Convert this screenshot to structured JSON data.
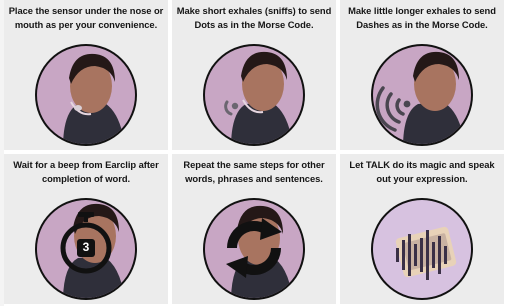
{
  "panels": [
    {
      "caption": "Place the sensor under the nose or\nmouth as per your convenience.",
      "icon": "face-sensor"
    },
    {
      "caption": "Make short exhales (sniffs) to send\nDots as in the Morse Code.",
      "icon": "short-exhale-waves"
    },
    {
      "caption": "Make little longer exhales to send\nDashes as in the Morse Code.",
      "icon": "long-exhale-waves"
    },
    {
      "caption": "Wait for a beep from Earclip after\ncompletion of word.",
      "icon": "stopwatch",
      "timer_value": "3"
    },
    {
      "caption": "Repeat the same steps for other\nwords, phrases and sentences.",
      "icon": "repeat-arrows"
    },
    {
      "caption": "Let TALK do its magic and speak\nout your expression.",
      "icon": "audio-waveform"
    }
  ],
  "colors": {
    "panel_bg": "#ececec",
    "ring": "#111111",
    "face_bg": "#c9a7c6",
    "skin": "#b07a63",
    "hair": "#241817",
    "icon_dark": "#1a1a1a",
    "waveform": "#3a3046"
  }
}
